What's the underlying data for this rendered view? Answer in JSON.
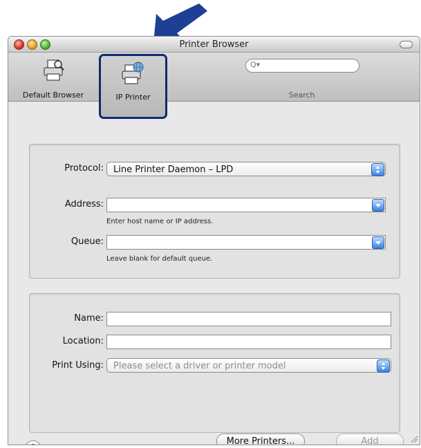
{
  "window": {
    "title": "Printer Browser"
  },
  "toolbar": {
    "default_browser_label": "Default Browser",
    "ip_printer_label": "IP Printer",
    "search_label": "Search",
    "search_placeholder": "Q▾"
  },
  "connection": {
    "protocol_label": "Protocol:",
    "protocol_value": "Line Printer Daemon – LPD",
    "address_label": "Address:",
    "address_value": "",
    "address_hint": "Enter host name or IP address.",
    "queue_label": "Queue:",
    "queue_value": "",
    "queue_hint": "Leave blank for default queue."
  },
  "details": {
    "name_label": "Name:",
    "name_value": "",
    "location_label": "Location:",
    "location_value": "",
    "print_using_label": "Print Using:",
    "print_using_value": "Please select a driver or printer model"
  },
  "footer": {
    "help_symbol": "?",
    "more_printers_label": "More Printers...",
    "add_label": "Add"
  },
  "colors": {
    "highlight_border": "#0f2a6e",
    "arrow": "#1d3f95",
    "stepper_blue": "#3a82e0"
  }
}
